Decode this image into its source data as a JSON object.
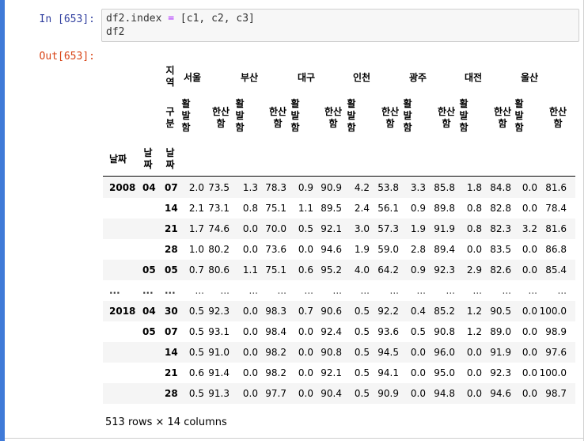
{
  "prompts": {
    "in": "In [653]:",
    "out": "Out[653]:"
  },
  "code": [
    "df2.index = [c1, c2, c3]",
    "df2"
  ],
  "table": {
    "col_level0_name": "지역",
    "col_level1_name": "구분",
    "regions": [
      "서울",
      "부산",
      "대구",
      "인천",
      "광주",
      "대전",
      "울산"
    ],
    "measures": [
      "활발함",
      "한산함"
    ],
    "index_names": [
      "날짜",
      "날짜",
      "날짜"
    ],
    "rows": [
      {
        "i0": "2008",
        "i1": "04",
        "i2": "07",
        "v": [
          "2.0",
          "73.5",
          "1.3",
          "78.3",
          "0.9",
          "90.9",
          "4.2",
          "53.8",
          "3.3",
          "85.8",
          "1.8",
          "84.8",
          "0.0",
          "81.6"
        ]
      },
      {
        "i0": "",
        "i1": "",
        "i2": "14",
        "v": [
          "2.1",
          "73.1",
          "0.8",
          "75.1",
          "1.1",
          "89.5",
          "2.4",
          "56.1",
          "0.9",
          "89.8",
          "0.8",
          "82.8",
          "0.0",
          "78.4"
        ]
      },
      {
        "i0": "",
        "i1": "",
        "i2": "21",
        "v": [
          "1.7",
          "74.6",
          "0.0",
          "70.0",
          "0.5",
          "92.1",
          "3.0",
          "57.3",
          "1.9",
          "91.9",
          "0.8",
          "82.3",
          "3.2",
          "81.6"
        ]
      },
      {
        "i0": "",
        "i1": "",
        "i2": "28",
        "v": [
          "1.0",
          "80.2",
          "0.0",
          "73.6",
          "0.0",
          "94.6",
          "1.9",
          "59.0",
          "2.8",
          "89.4",
          "0.0",
          "83.5",
          "0.0",
          "86.8"
        ]
      },
      {
        "i0": "",
        "i1": "05",
        "i2": "05",
        "v": [
          "0.7",
          "80.6",
          "1.1",
          "75.1",
          "0.6",
          "95.2",
          "4.0",
          "64.2",
          "0.9",
          "92.3",
          "2.9",
          "82.6",
          "0.0",
          "85.4"
        ]
      },
      {
        "i0": "...",
        "i1": "...",
        "i2": "...",
        "v": [
          "...",
          "...",
          "...",
          "...",
          "...",
          "...",
          "...",
          "...",
          "...",
          "...",
          "...",
          "...",
          "...",
          "..."
        ]
      },
      {
        "i0": "2018",
        "i1": "04",
        "i2": "30",
        "v": [
          "0.5",
          "92.3",
          "0.0",
          "98.3",
          "0.7",
          "90.6",
          "0.5",
          "92.2",
          "0.4",
          "85.2",
          "1.2",
          "90.5",
          "0.0",
          "100.0"
        ]
      },
      {
        "i0": "",
        "i1": "05",
        "i2": "07",
        "v": [
          "0.5",
          "93.1",
          "0.0",
          "98.4",
          "0.0",
          "92.4",
          "0.5",
          "93.6",
          "0.5",
          "90.8",
          "1.2",
          "89.0",
          "0.0",
          "98.9"
        ]
      },
      {
        "i0": "",
        "i1": "",
        "i2": "14",
        "v": [
          "0.5",
          "91.0",
          "0.0",
          "98.2",
          "0.0",
          "90.8",
          "0.5",
          "94.5",
          "0.0",
          "96.0",
          "0.0",
          "91.9",
          "0.0",
          "97.6"
        ]
      },
      {
        "i0": "",
        "i1": "",
        "i2": "21",
        "v": [
          "0.6",
          "91.4",
          "0.0",
          "98.2",
          "0.0",
          "92.1",
          "0.5",
          "94.1",
          "0.0",
          "95.0",
          "0.0",
          "92.3",
          "0.0",
          "100.0"
        ]
      },
      {
        "i0": "",
        "i1": "",
        "i2": "28",
        "v": [
          "0.5",
          "91.3",
          "0.0",
          "97.7",
          "0.0",
          "90.4",
          "0.5",
          "90.9",
          "0.0",
          "94.8",
          "0.0",
          "94.6",
          "0.0",
          "98.7"
        ]
      }
    ]
  },
  "footer": "513 rows × 14 columns"
}
